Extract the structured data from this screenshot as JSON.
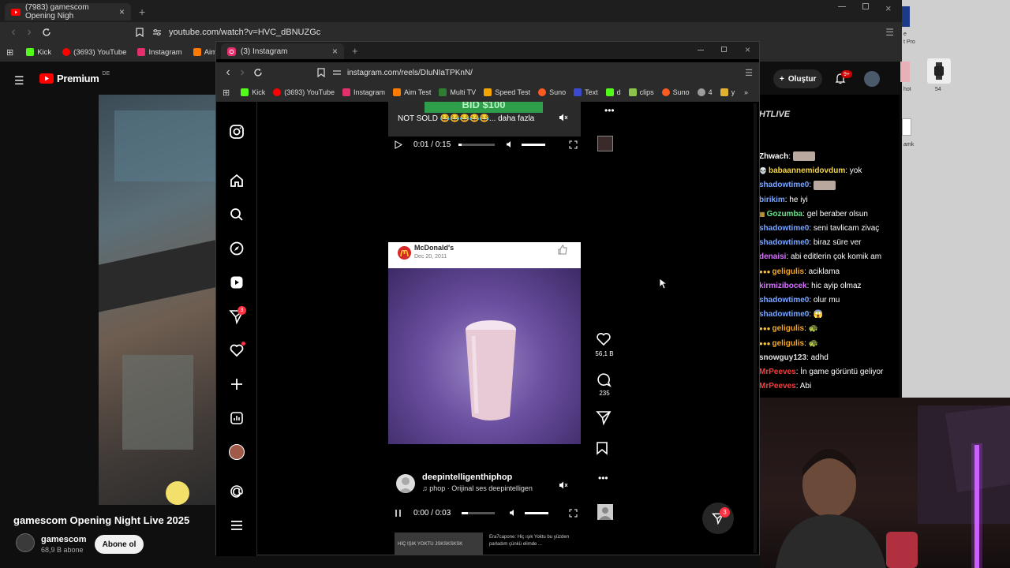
{
  "yt_browser": {
    "tab_title": "(7983) gamescom Opening Nigh",
    "url": "youtube.com/watch?v=HVC_dBNUZGc",
    "bookmarks": [
      {
        "label": "Kick",
        "color": "#53fc18"
      },
      {
        "label": "(3693) YouTube",
        "color": "#ff0000"
      },
      {
        "label": "Instagram",
        "color": "#e1306c"
      },
      {
        "label": "Aim Test",
        "color": "#ff7a00"
      }
    ]
  },
  "youtube": {
    "logo_text": "Premium",
    "region": "DE",
    "create_label": "Oluştur",
    "notifications_badge": "9+",
    "video_title": "gamescom Opening Night Live 2025",
    "channel_name": "gamescom",
    "subscribers": "68,9 B abone",
    "subscribe_label": "Abone ol"
  },
  "ig_browser": {
    "tab_title": "(3) Instagram",
    "url": "instagram.com/reels/DIuNIaTPKnN/",
    "bookmarks": [
      {
        "label": "Kick",
        "color": "#53fc18"
      },
      {
        "label": "(3693) YouTube",
        "color": "#ff0000"
      },
      {
        "label": "Instagram",
        "color": "#e1306c"
      },
      {
        "label": "Aim Test",
        "color": "#ff7a00"
      },
      {
        "label": "Multi TV",
        "color": "#2e7d32"
      },
      {
        "label": "Speed Test",
        "color": "#f4a300"
      },
      {
        "label": "Suno",
        "color": "#ff5a1f"
      },
      {
        "label": "Text",
        "color": "#3a4bd0"
      },
      {
        "label": "d",
        "color": "#53fc18"
      },
      {
        "label": "clips",
        "color": "#8bc34a"
      },
      {
        "label": "Suno",
        "color": "#ff5a1f"
      },
      {
        "label": "4",
        "color": "#9e9e9e"
      },
      {
        "label": "y",
        "color": "#e0b030"
      }
    ]
  },
  "instagram": {
    "sidebar_badge": "3",
    "top_reel": {
      "caption": "NOT SOLD 😂😂😂😂😂... daha fazla",
      "banner": "BID $100",
      "time": "0:01 / 0:15"
    },
    "main_reel": {
      "post_author": "McDonald's",
      "post_date": "Dec 20, 2011",
      "likes": "56,1 B",
      "comments": "235",
      "username": "deepintelligenthiphop",
      "audio": "phop · Orijinal ses   deepintelligen",
      "time": "0:00 / 0:03"
    },
    "next_reel_caption_left": "HİÇ IŞIK YOKTU JSKSKSKSK",
    "next_reel_caption_right": "Era7capone: Hiç ışık Yoktu bu yüzden parladım çünkü elimde ...",
    "messages_badge": "3"
  },
  "chat": {
    "header": "HTLIVE",
    "messages": [
      {
        "user": "Zhwach",
        "text": "",
        "color": "#ffffff",
        "emote": true
      },
      {
        "user": "babaannemidovdum",
        "text": "yok",
        "color": "#f5d547",
        "prefix": "💀"
      },
      {
        "user": "shadowtime0",
        "text": "",
        "color": "#7aa6ff",
        "emote": true
      },
      {
        "user": "birikim",
        "text": "he iyi",
        "color": "#7aa6ff"
      },
      {
        "user": "Gozumba",
        "text": "gel beraber olsun",
        "color": "#68e38b",
        "prefix": "▦"
      },
      {
        "user": "shadowtime0",
        "text": "seni tavlicam zivaç",
        "color": "#7aa6ff"
      },
      {
        "user": "shadowtime0",
        "text": "biraz süre ver",
        "color": "#7aa6ff"
      },
      {
        "user": "denaisi",
        "text": "abi editlerin çok komik am",
        "color": "#d874ff"
      },
      {
        "user": "geligulis",
        "text": "aciklama",
        "color": "#f5a623",
        "prefix": "●●●"
      },
      {
        "user": "kirmizibocek",
        "text": "hic ayip olmaz",
        "color": "#d874ff"
      },
      {
        "user": "shadowtime0",
        "text": "olur mu",
        "color": "#7aa6ff"
      },
      {
        "user": "shadowtime0",
        "text": "😱",
        "color": "#7aa6ff"
      },
      {
        "user": "geligulis",
        "text": "🐢",
        "color": "#f5a623",
        "prefix": "●●●"
      },
      {
        "user": "geligulis",
        "text": "🐢",
        "color": "#f5a623",
        "prefix": "●●●"
      },
      {
        "user": "snowguy123",
        "text": "adhd",
        "color": "#e0e0e0"
      },
      {
        "user": "MrPeeves",
        "text": "İn game görüntü geliyor",
        "color": "#ff3b3b"
      },
      {
        "user": "MrPeeves",
        "text": "Abi",
        "color": "#ff3b3b"
      }
    ]
  },
  "desktop": {
    "icon_labels": [
      "hot",
      "54",
      "amk"
    ],
    "top_label": "e",
    "top_label2": "t Pro"
  },
  "colors": {
    "instagram_red": "#ff3040",
    "youtube_red": "#ff0000",
    "ig_background": "#000000",
    "video_purple": "#6b4fa0"
  }
}
